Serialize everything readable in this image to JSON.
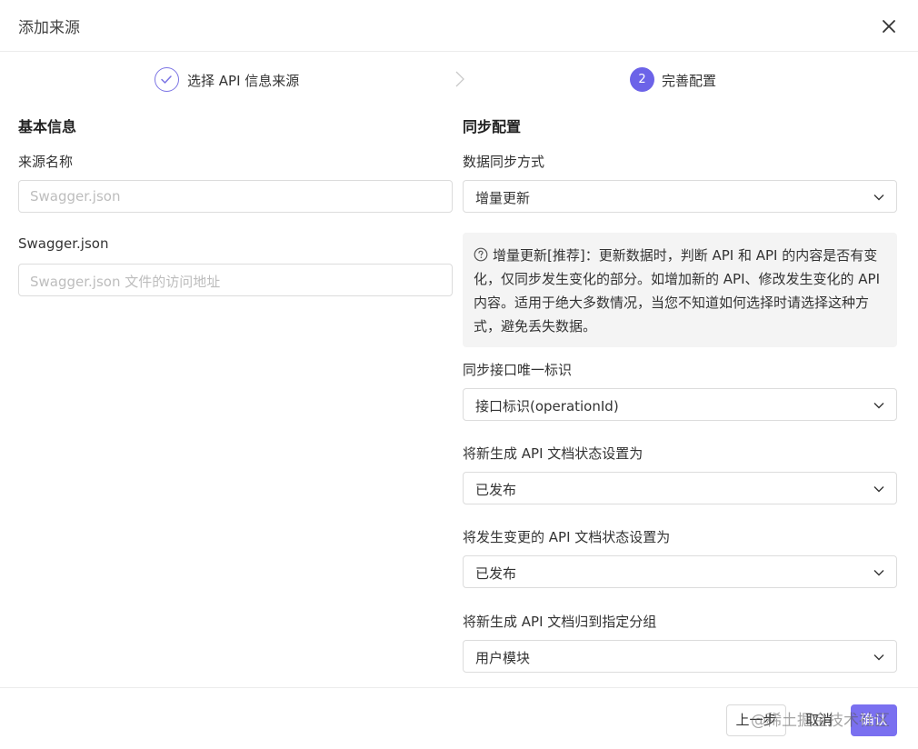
{
  "dialog": {
    "title": "添加来源"
  },
  "steps": [
    {
      "label": "选择 API 信息来源",
      "state": "done"
    },
    {
      "number": "2",
      "label": "完善配置",
      "state": "active"
    }
  ],
  "basic": {
    "section_title": "基本信息",
    "source_name": {
      "label": "来源名称",
      "placeholder": "Swagger.json"
    },
    "swagger_json": {
      "label": "Swagger.json",
      "placeholder": "Swagger.json 文件的访问地址"
    }
  },
  "sync": {
    "section_title": "同步配置",
    "method": {
      "label": "数据同步方式",
      "value": "增量更新"
    },
    "info_text": "增量更新[推荐]：更新数据时，判断 API 和 API 的内容是否有变化，仅同步发生变化的部分。如增加新的 API、修改发生变化的 API 内容。适用于绝大多数情况，当您不知道如何选择时请选择这种方式，避免丢失数据。",
    "unique_id": {
      "label": "同步接口唯一标识",
      "value": "接口标识(operationId)"
    },
    "new_status": {
      "label": "将新生成 API 文档状态设置为",
      "value": "已发布"
    },
    "changed_status": {
      "label": "将发生变更的 API 文档状态设置为",
      "value": "已发布"
    },
    "group": {
      "label": "将新生成 API 文档归到指定分组",
      "value": "用户模块"
    }
  },
  "footer": {
    "prev_label": "上一步",
    "cancel_label": "取消",
    "ok_label": "确认",
    "watermark": "@稀土掘金技术社区"
  },
  "colors": {
    "accent": "#6c63e8",
    "button": "#7a70f0",
    "info_bg": "#f4f4f4"
  },
  "icons": {
    "close": "close-icon",
    "step_done": "check-icon",
    "step_sep": "chevron-right-icon",
    "select": "chevron-down-icon",
    "help": "question-circle-icon"
  }
}
